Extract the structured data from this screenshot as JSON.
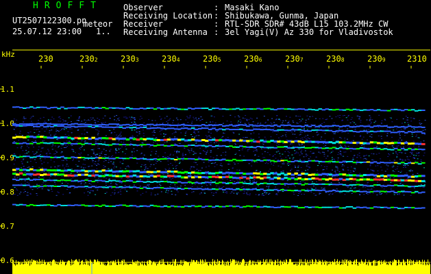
{
  "header": {
    "brand": "HROFFT",
    "filename": "UT2507122300.pn",
    "mode_label": "meteor",
    "timestamp": "25.07.12 23:00",
    "timestamp_suffix": "1.."
  },
  "meta": [
    {
      "label": "Observer",
      "value": "Masaki Kano"
    },
    {
      "label": "Receiving Location",
      "value": "Shibukawa, Gunma, Japan"
    },
    {
      "label": "Receiver",
      "value": "RTL-SDR SDR# 43dB L15 103.2MHz CW"
    },
    {
      "label": "Receiving Antenna",
      "value": "3el Yagi(V) Az 330 for Vladivostok"
    }
  ],
  "meta_separator": ":",
  "plot": {
    "y_unit": "kHz",
    "y_ticks": [
      "1.1",
      "1.0",
      "0.9",
      "0.8",
      "0.7",
      "0.6"
    ],
    "y_tick_values": [
      1.1,
      1.0,
      0.9,
      0.8,
      0.7,
      0.6
    ],
    "x_ticks": [
      "230",
      "230",
      "230",
      "230",
      "230",
      "230",
      "230",
      "230",
      "230",
      "2310"
    ],
    "x_tick_suffixes": [
      "",
      "2",
      "3",
      "4",
      "5",
      "6",
      "7",
      "8",
      "9",
      ""
    ],
    "bands": [
      {
        "freq": 1.048,
        "intensity": 0.45
      },
      {
        "freq": 1.0,
        "intensity": 0.25
      },
      {
        "freq": 0.995,
        "intensity": 0.3
      },
      {
        "freq": 0.963,
        "intensity": 0.8
      },
      {
        "freq": 0.945,
        "intensity": 0.55
      },
      {
        "freq": 0.905,
        "intensity": 0.6
      },
      {
        "freq": 0.868,
        "intensity": 0.7
      },
      {
        "freq": 0.855,
        "intensity": 1.0
      },
      {
        "freq": 0.838,
        "intensity": 0.55
      },
      {
        "freq": 0.82,
        "intensity": 0.5
      },
      {
        "freq": 0.763,
        "intensity": 0.55
      }
    ]
  },
  "colors": {
    "yellow": "#ffff00",
    "green": "#00ff00",
    "white": "#ffffff",
    "noise_dark": "#1a1aa8",
    "noise_mid": "#2f5fff",
    "noise_bright": "#00e0e0",
    "hot": "#ff3030"
  }
}
